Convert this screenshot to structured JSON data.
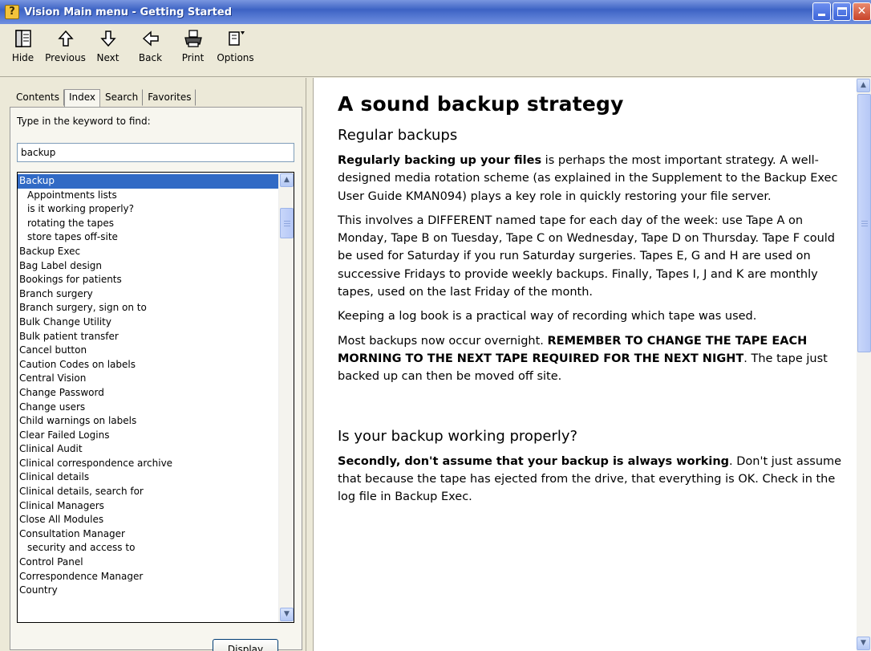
{
  "window": {
    "title": "Vision Main menu - Getting Started"
  },
  "toolbar": {
    "buttons": [
      {
        "label": "Hide",
        "icon": "hide-pane-icon"
      },
      {
        "label": "Previous",
        "icon": "arrow-up-icon"
      },
      {
        "label": "Next",
        "icon": "arrow-down-icon"
      },
      {
        "label": "Back",
        "icon": "arrow-left-icon"
      },
      {
        "label": "Print",
        "icon": "printer-icon"
      },
      {
        "label": "Options",
        "icon": "options-icon"
      }
    ]
  },
  "navigation": {
    "tabs": [
      "Contents",
      "Index",
      "Search",
      "Favorites"
    ],
    "active_tab": "Index",
    "prompt": "Type in the keyword to find:",
    "keyword_value": "backup",
    "display_button": "Display",
    "index_items": [
      {
        "text": "Backup",
        "sub": false,
        "selected": true
      },
      {
        "text": "Appointments lists",
        "sub": true
      },
      {
        "text": "is it working properly?",
        "sub": true
      },
      {
        "text": "rotating the tapes",
        "sub": true
      },
      {
        "text": "store tapes off-site",
        "sub": true
      },
      {
        "text": "Backup Exec",
        "sub": false
      },
      {
        "text": "Bag Label design",
        "sub": false
      },
      {
        "text": "Bookings for patients",
        "sub": false
      },
      {
        "text": "Branch surgery",
        "sub": false
      },
      {
        "text": "Branch surgery, sign on to",
        "sub": false
      },
      {
        "text": "Bulk Change Utility",
        "sub": false
      },
      {
        "text": "Bulk patient transfer",
        "sub": false
      },
      {
        "text": "Cancel button",
        "sub": false
      },
      {
        "text": "Caution Codes on labels",
        "sub": false
      },
      {
        "text": "Central Vision",
        "sub": false
      },
      {
        "text": "Change Password",
        "sub": false
      },
      {
        "text": "Change users",
        "sub": false
      },
      {
        "text": "Child warnings on labels",
        "sub": false
      },
      {
        "text": "Clear Failed Logins",
        "sub": false
      },
      {
        "text": "Clinical Audit",
        "sub": false
      },
      {
        "text": "Clinical correspondence archive",
        "sub": false
      },
      {
        "text": "Clinical details",
        "sub": false
      },
      {
        "text": "Clinical details, search for",
        "sub": false
      },
      {
        "text": "Clinical Managers",
        "sub": false
      },
      {
        "text": "Close All Modules",
        "sub": false
      },
      {
        "text": "Consultation Manager",
        "sub": false
      },
      {
        "text": "security and access to",
        "sub": true
      },
      {
        "text": "Control Panel",
        "sub": false
      },
      {
        "text": "Correspondence Manager",
        "sub": false
      },
      {
        "text": "Country",
        "sub": false
      }
    ]
  },
  "document": {
    "title": "A sound backup strategy",
    "section1_heading": "Regular backups",
    "p1_bold": "Regularly backing up your files",
    "p1_rest": " is perhaps the most important strategy.  A well-designed media rotation scheme (as explained in the Supplement to the Backup Exec User Guide KMAN094) plays a key role in quickly restoring your file server.",
    "p2": "This involves a DIFFERENT named tape for each day of the week: use Tape A on Monday, Tape B on Tuesday, Tape C on Wednesday, Tape D on Thursday.  Tape F could be used for Saturday if you run Saturday surgeries.   Tapes E, G and H are used on successive Fridays to provide weekly backups.   Finally, Tapes I, J and K are monthly tapes, used on the last Friday of the month.",
    "p3": "Keeping a log book is a practical way of recording which tape was used.",
    "p4_start": "Most backups now occur overnight.  ",
    "p4_bold": "REMEMBER TO CHANGE THE TAPE EACH MORNING TO THE NEXT TAPE REQUIRED FOR THE NEXT NIGHT",
    "p4_end": ".  The tape just backed up can then be moved off site.",
    "section2_heading": "Is your backup working properly?",
    "p5_bold": "Secondly, don't assume that your backup is always working",
    "p5_rest": ".  Don't just assume that because the tape has ejected from the drive, that everything is OK.  Check in the log file in Backup Exec."
  },
  "colors": {
    "titlebar": "#3d63c4",
    "selection": "#316ac5",
    "chrome": "#ece9d8"
  }
}
